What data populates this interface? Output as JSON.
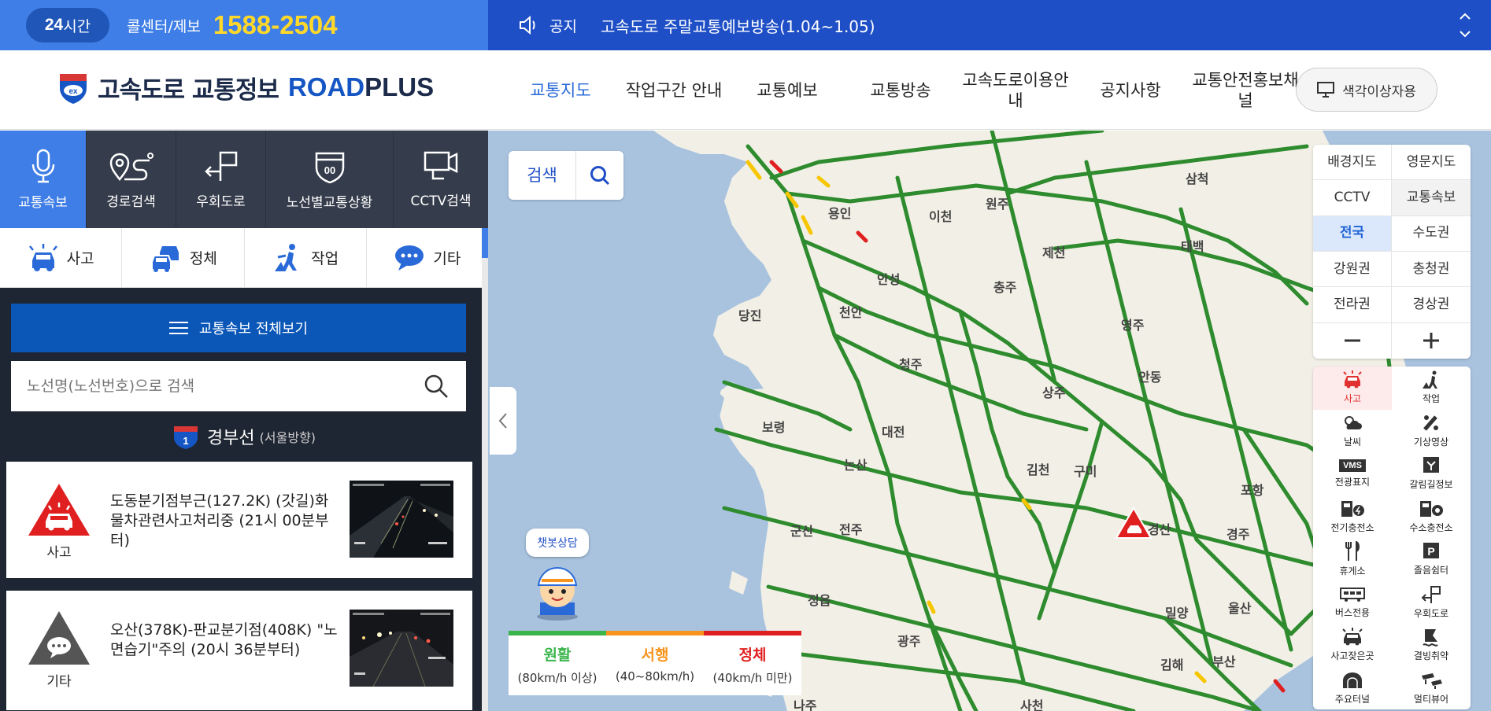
{
  "topbar": {
    "hours_pill_num": "24",
    "hours_pill_text": "시간",
    "callcenter": "콜센터/제보",
    "phone": "1588-2504",
    "notice_label": "공지",
    "notice_text": "고속도로 주말교통예보방송(1.04~1.05)"
  },
  "header": {
    "logo_title": "고속도로 교통정보",
    "logo_road": "ROAD",
    "logo_plus": "PLUS",
    "nav": [
      "교통지도",
      "작업구간 안내",
      "교통예보",
      "교통방송",
      "고속도로이용안내",
      "공지사항",
      "교통안전홍보채널"
    ],
    "color_btn": "색각이상자용"
  },
  "left": {
    "tabs": [
      "교통속보",
      "경로검색",
      "우회도로",
      "노선별교통상황",
      "CCTV검색"
    ],
    "categories": [
      "사고",
      "정체",
      "작업",
      "기타"
    ],
    "full_view": "교통속보 전체보기",
    "search_placeholder": "노선명(노선번호)으로 검색",
    "route_number": "1",
    "route_name": "경부선",
    "route_dir": "(서울방향)",
    "cards": [
      {
        "type": "사고",
        "text": "도동분기점부근(127.2K) (갓길)화물차관련사고처리중 (21시 00분부터)"
      },
      {
        "type": "기타",
        "text": "오산(378K)-판교분기점(408K) \"노면습기\"주의 (20시 36분부터)"
      }
    ]
  },
  "map": {
    "search_label": "검색",
    "chatbot": "챗봇상담",
    "legend": [
      {
        "name": "원활",
        "range": "(80km/h 이상)",
        "color": "#39b54a"
      },
      {
        "name": "서행",
        "range": "(40~80km/h)",
        "color": "#f7941d"
      },
      {
        "name": "정체",
        "range": "(40km/h 미만)",
        "color": "#e02020"
      }
    ],
    "panel1": [
      "배경지도",
      "영문지도",
      "CCTV",
      "교통속보",
      "전국",
      "수도권",
      "강원권",
      "충청권",
      "전라권",
      "경상권"
    ],
    "panel2": [
      "사고",
      "작업",
      "날씨",
      "기상영상",
      "전광표지",
      "갈림길정보",
      "전기충전소",
      "수소충전소",
      "휴게소",
      "졸음쉼터",
      "버스전용",
      "우회도로",
      "사고잦은곳",
      "결빙취약",
      "주요터널",
      "멀티뷰어"
    ],
    "vms_label": "VMS",
    "parking_label": "P",
    "cities": [
      "삼척",
      "태백",
      "이천",
      "제천",
      "충주",
      "안성",
      "당진",
      "천안",
      "영주",
      "청주",
      "안동",
      "상주",
      "보령",
      "대전",
      "논산",
      "김천",
      "구미",
      "포항",
      "군산",
      "전주",
      "경산",
      "경주",
      "정읍",
      "밀양",
      "울산",
      "광주",
      "김해",
      "부산",
      "나주",
      "사천",
      "용인",
      "원주"
    ]
  }
}
